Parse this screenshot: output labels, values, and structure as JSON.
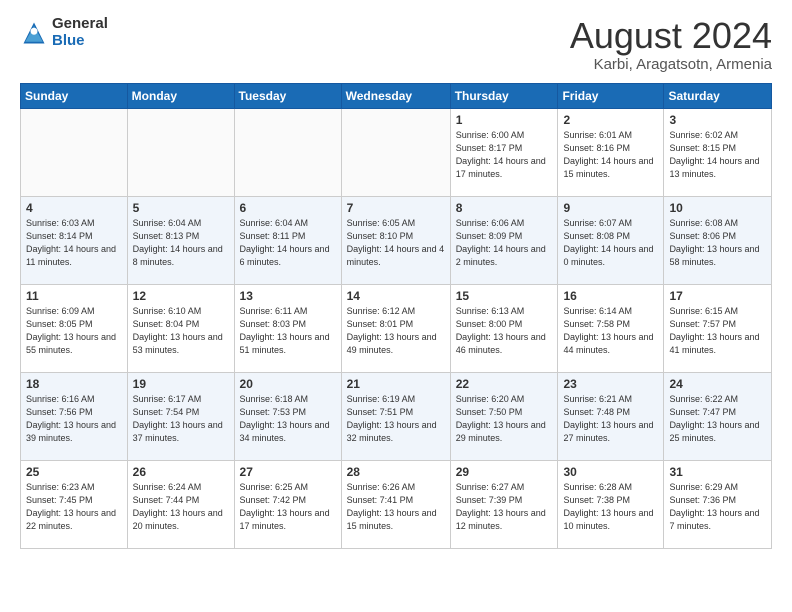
{
  "header": {
    "logo_general": "General",
    "logo_blue": "Blue",
    "month_title": "August 2024",
    "location": "Karbi, Aragatsotn, Armenia"
  },
  "days_of_week": [
    "Sunday",
    "Monday",
    "Tuesday",
    "Wednesday",
    "Thursday",
    "Friday",
    "Saturday"
  ],
  "weeks": [
    [
      {
        "day": "",
        "info": ""
      },
      {
        "day": "",
        "info": ""
      },
      {
        "day": "",
        "info": ""
      },
      {
        "day": "",
        "info": ""
      },
      {
        "day": "1",
        "info": "Sunrise: 6:00 AM\nSunset: 8:17 PM\nDaylight: 14 hours\nand 17 minutes."
      },
      {
        "day": "2",
        "info": "Sunrise: 6:01 AM\nSunset: 8:16 PM\nDaylight: 14 hours\nand 15 minutes."
      },
      {
        "day": "3",
        "info": "Sunrise: 6:02 AM\nSunset: 8:15 PM\nDaylight: 14 hours\nand 13 minutes."
      }
    ],
    [
      {
        "day": "4",
        "info": "Sunrise: 6:03 AM\nSunset: 8:14 PM\nDaylight: 14 hours\nand 11 minutes."
      },
      {
        "day": "5",
        "info": "Sunrise: 6:04 AM\nSunset: 8:13 PM\nDaylight: 14 hours\nand 8 minutes."
      },
      {
        "day": "6",
        "info": "Sunrise: 6:04 AM\nSunset: 8:11 PM\nDaylight: 14 hours\nand 6 minutes."
      },
      {
        "day": "7",
        "info": "Sunrise: 6:05 AM\nSunset: 8:10 PM\nDaylight: 14 hours\nand 4 minutes."
      },
      {
        "day": "8",
        "info": "Sunrise: 6:06 AM\nSunset: 8:09 PM\nDaylight: 14 hours\nand 2 minutes."
      },
      {
        "day": "9",
        "info": "Sunrise: 6:07 AM\nSunset: 8:08 PM\nDaylight: 14 hours\nand 0 minutes."
      },
      {
        "day": "10",
        "info": "Sunrise: 6:08 AM\nSunset: 8:06 PM\nDaylight: 13 hours\nand 58 minutes."
      }
    ],
    [
      {
        "day": "11",
        "info": "Sunrise: 6:09 AM\nSunset: 8:05 PM\nDaylight: 13 hours\nand 55 minutes."
      },
      {
        "day": "12",
        "info": "Sunrise: 6:10 AM\nSunset: 8:04 PM\nDaylight: 13 hours\nand 53 minutes."
      },
      {
        "day": "13",
        "info": "Sunrise: 6:11 AM\nSunset: 8:03 PM\nDaylight: 13 hours\nand 51 minutes."
      },
      {
        "day": "14",
        "info": "Sunrise: 6:12 AM\nSunset: 8:01 PM\nDaylight: 13 hours\nand 49 minutes."
      },
      {
        "day": "15",
        "info": "Sunrise: 6:13 AM\nSunset: 8:00 PM\nDaylight: 13 hours\nand 46 minutes."
      },
      {
        "day": "16",
        "info": "Sunrise: 6:14 AM\nSunset: 7:58 PM\nDaylight: 13 hours\nand 44 minutes."
      },
      {
        "day": "17",
        "info": "Sunrise: 6:15 AM\nSunset: 7:57 PM\nDaylight: 13 hours\nand 41 minutes."
      }
    ],
    [
      {
        "day": "18",
        "info": "Sunrise: 6:16 AM\nSunset: 7:56 PM\nDaylight: 13 hours\nand 39 minutes."
      },
      {
        "day": "19",
        "info": "Sunrise: 6:17 AM\nSunset: 7:54 PM\nDaylight: 13 hours\nand 37 minutes."
      },
      {
        "day": "20",
        "info": "Sunrise: 6:18 AM\nSunset: 7:53 PM\nDaylight: 13 hours\nand 34 minutes."
      },
      {
        "day": "21",
        "info": "Sunrise: 6:19 AM\nSunset: 7:51 PM\nDaylight: 13 hours\nand 32 minutes."
      },
      {
        "day": "22",
        "info": "Sunrise: 6:20 AM\nSunset: 7:50 PM\nDaylight: 13 hours\nand 29 minutes."
      },
      {
        "day": "23",
        "info": "Sunrise: 6:21 AM\nSunset: 7:48 PM\nDaylight: 13 hours\nand 27 minutes."
      },
      {
        "day": "24",
        "info": "Sunrise: 6:22 AM\nSunset: 7:47 PM\nDaylight: 13 hours\nand 25 minutes."
      }
    ],
    [
      {
        "day": "25",
        "info": "Sunrise: 6:23 AM\nSunset: 7:45 PM\nDaylight: 13 hours\nand 22 minutes."
      },
      {
        "day": "26",
        "info": "Sunrise: 6:24 AM\nSunset: 7:44 PM\nDaylight: 13 hours\nand 20 minutes."
      },
      {
        "day": "27",
        "info": "Sunrise: 6:25 AM\nSunset: 7:42 PM\nDaylight: 13 hours\nand 17 minutes."
      },
      {
        "day": "28",
        "info": "Sunrise: 6:26 AM\nSunset: 7:41 PM\nDaylight: 13 hours\nand 15 minutes."
      },
      {
        "day": "29",
        "info": "Sunrise: 6:27 AM\nSunset: 7:39 PM\nDaylight: 13 hours\nand 12 minutes."
      },
      {
        "day": "30",
        "info": "Sunrise: 6:28 AM\nSunset: 7:38 PM\nDaylight: 13 hours\nand 10 minutes."
      },
      {
        "day": "31",
        "info": "Sunrise: 6:29 AM\nSunset: 7:36 PM\nDaylight: 13 hours\nand 7 minutes."
      }
    ]
  ]
}
